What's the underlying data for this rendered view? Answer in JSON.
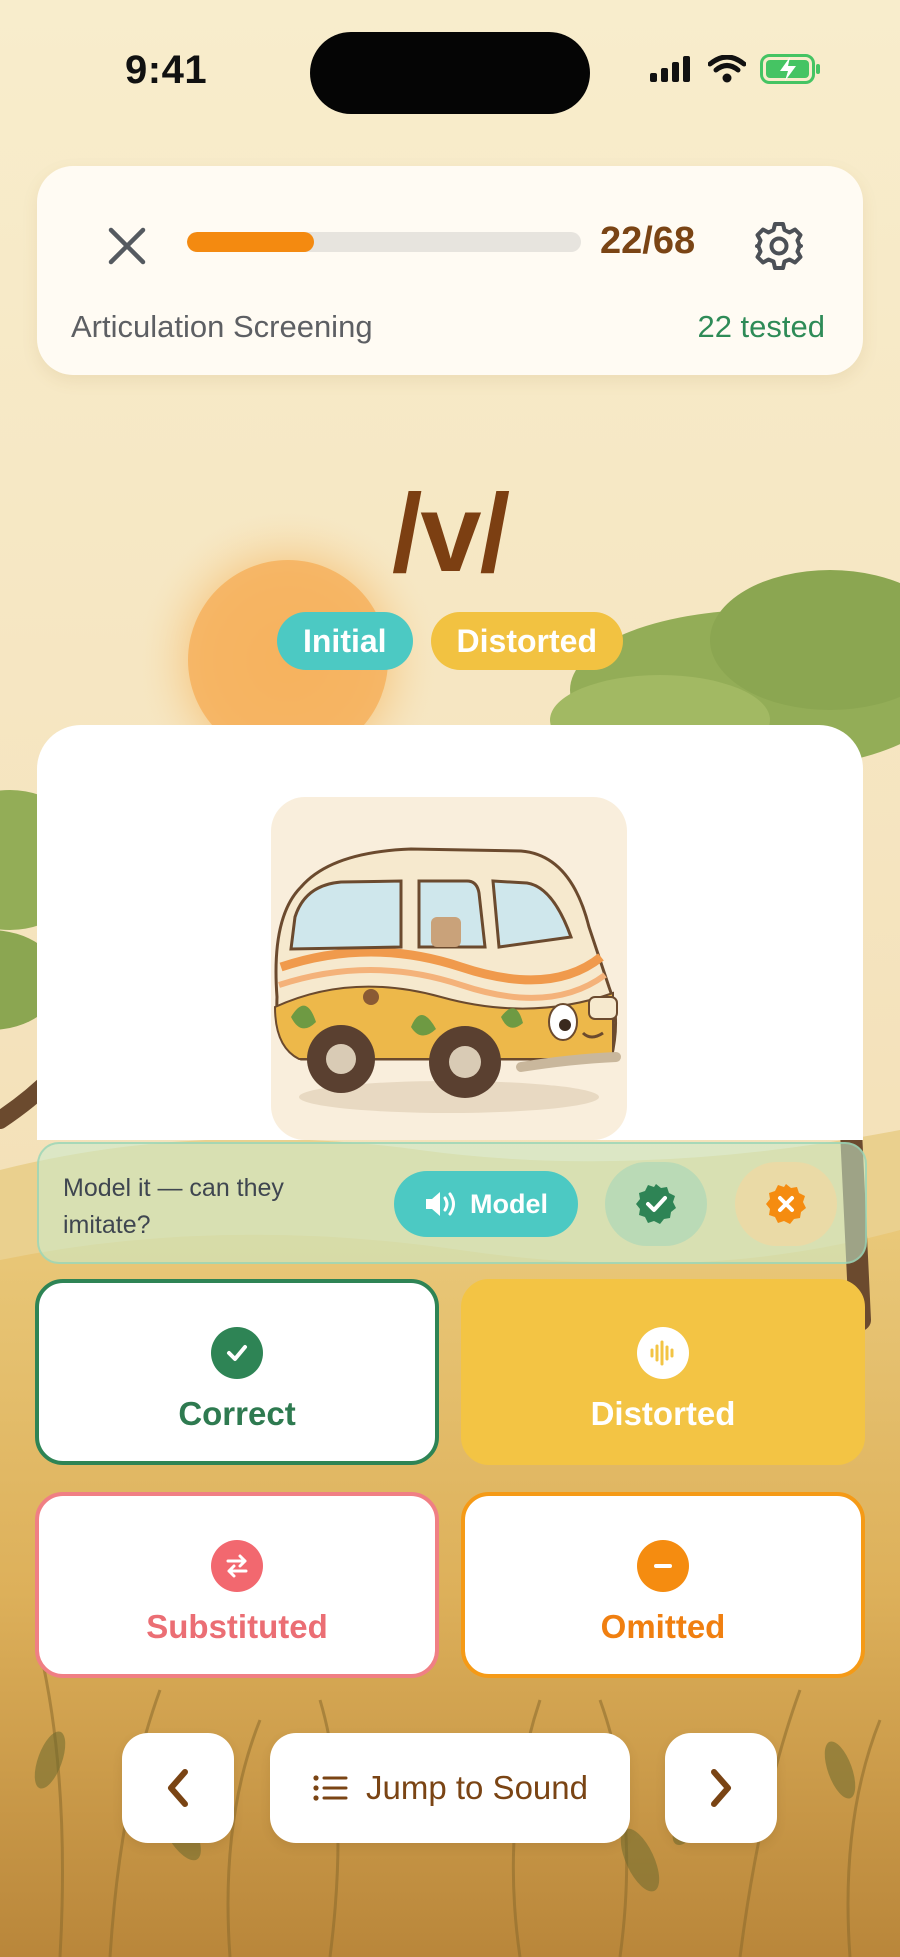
{
  "status_bar": {
    "time": "9:41",
    "icons": [
      "signal-icon",
      "wifi-icon",
      "battery-charging-icon"
    ]
  },
  "header": {
    "close_icon": "close-icon",
    "progress": {
      "current": 22,
      "total": 68,
      "fraction": 0.3235
    },
    "count_label": "22/68",
    "settings_icon": "gear-icon",
    "screen_title": "Articulation Screening",
    "tested_label": "22 tested"
  },
  "target": {
    "phoneme": "/v/",
    "position_tag": "Initial",
    "status_tag": "Distorted"
  },
  "picture": {
    "subject": "van",
    "icon": "van-illustration"
  },
  "model_bar": {
    "prompt": "Model it — can they imitate?",
    "model_button": "Model",
    "model_icon": "speaker-icon",
    "imitated_icon": "check-badge-icon",
    "not_imitated_icon": "x-badge-icon"
  },
  "scoring": [
    {
      "label": "Correct",
      "icon": "check-icon",
      "color": "#2E8455",
      "selected": false
    },
    {
      "label": "Distorted",
      "icon": "waveform-icon",
      "color": "#F3C444",
      "selected": true
    },
    {
      "label": "Substituted",
      "icon": "swap-icon",
      "color": "#F2686F",
      "selected": false
    },
    {
      "label": "Omitted",
      "icon": "minus-icon",
      "color": "#F58C10",
      "selected": false
    }
  ],
  "nav": {
    "prev_icon": "chevron-left-icon",
    "jump_label": "Jump to Sound",
    "jump_icon": "list-icon",
    "next_icon": "chevron-right-icon"
  },
  "colors": {
    "accent_orange": "#F48A10",
    "brown_text": "#7A4414",
    "teal": "#4CC9C3",
    "green": "#2E8B57"
  }
}
